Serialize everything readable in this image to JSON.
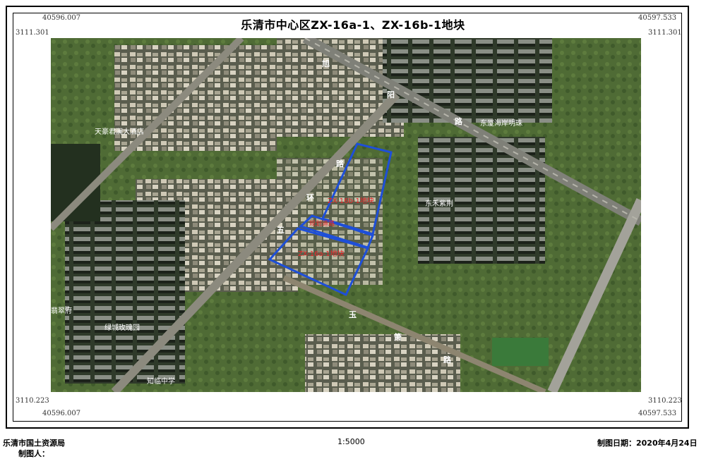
{
  "title": "乐清市中心区ZX-16a-1、ZX-16b-1地块",
  "coords": {
    "top_left_x": "40596.007",
    "top_right_x": "40597.533",
    "top_left_y": "3111.301",
    "top_right_y": "3111.301",
    "bottom_left_y": "3110.223",
    "bottom_right_y": "3110.223",
    "bottom_left_x": "40596.007",
    "bottom_right_x": "40597.533"
  },
  "map_labels": {
    "xu": "旭",
    "yang": "阳",
    "lu1": "路",
    "lu2": "路",
    "huan": "环",
    "wu": "五",
    "yu": "玉",
    "xiao": "箫",
    "lu3": "路",
    "tianhao": "天豪君澜大酒店",
    "donghai": "东厦海岸明珠",
    "donghe": "东禾紫荆",
    "feicui": "翡翠府",
    "lvcheng": "绿城玫瑰园",
    "zhilin": "知临中学",
    "parcel_b": "ZX-16b-1地块",
    "parcel_mid": "规划道路",
    "parcel_a": "ZX-16a-1地块"
  },
  "colors": {
    "parcel_outline": "#1e4fd8",
    "parcel_text": "#e8262a",
    "place_text": "#ffffff"
  },
  "footer": {
    "agency": "乐清市国土资源局",
    "maker": "制图人：",
    "scale": "1:5000",
    "date": "制图日期：2020年4月24日"
  }
}
